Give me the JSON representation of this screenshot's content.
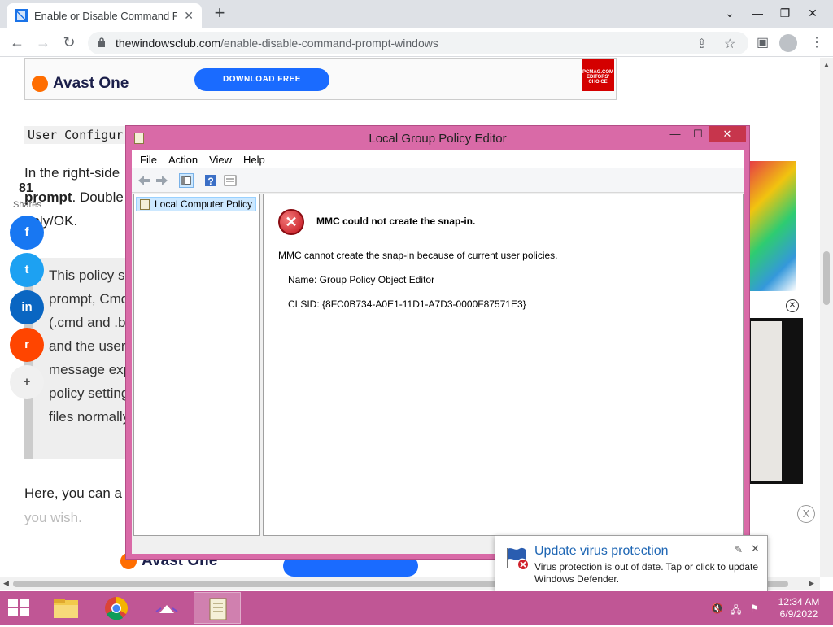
{
  "browser": {
    "tab_title": "Enable or Disable Command Pro",
    "tab_close": "✕",
    "new_tab": "+",
    "url_domain": "thewindowsclub.com",
    "url_path": "/enable-disable-command-prompt-windows",
    "window_controls": {
      "chevron": "⌄",
      "minimize": "—",
      "restore": "❐",
      "close": "✕"
    }
  },
  "page": {
    "ad_top": {
      "brand": "Avast One",
      "button": "DOWNLOAD FREE",
      "badge": "PCMAG.COM EDITORS' CHOICE"
    },
    "code_line": "User Configur",
    "para1_line1": "In the right-side",
    "para1_line2_bold": "prompt",
    "para1_line2_rest": ". Double",
    "para1_line3": "pply/OK.",
    "quote_lines": [
      "This policy se",
      "prompt, Cmd",
      "(.cmd and .ba",
      "and the user",
      "message exp",
      "policy setting",
      "files normally"
    ],
    "para2_line1": "Here, you can a",
    "para2_line2": "you wish.",
    "share_count": "81",
    "share_label": "Shares",
    "share_buttons": [
      {
        "name": "facebook",
        "glyph": "f",
        "color": "#1877f2"
      },
      {
        "name": "twitter",
        "glyph": "t",
        "color": "#1da1f2"
      },
      {
        "name": "linkedin",
        "glyph": "in",
        "color": "#0a66c2"
      },
      {
        "name": "reddit",
        "glyph": "r",
        "color": "#ff4500"
      },
      {
        "name": "more",
        "glyph": "+",
        "color": "#f0f0f0"
      }
    ],
    "side_ad_close": "✕",
    "ad_bottom": {
      "brand": "Avast One",
      "close": "X"
    }
  },
  "mmc": {
    "title": "Local Group Policy Editor",
    "controls": {
      "minimize": "—",
      "maximize": "☐",
      "close": "✕"
    },
    "menu": [
      "File",
      "Action",
      "View",
      "Help"
    ],
    "tree_node": "Local Computer Policy",
    "error_title": "MMC could not create the snap-in.",
    "error_message": "MMC cannot create the snap-in because of current user policies.",
    "name_line": "Name: Group Policy Object Editor",
    "clsid_line": "CLSID: {8FC0B734-A0E1-11D1-A7D3-0000F87571E3}"
  },
  "notification": {
    "title": "Update virus protection",
    "body": "Virus protection is out of date. Tap or click to update Windows Defender.",
    "close": "✕"
  },
  "taskbar": {
    "time": "12:34 AM",
    "date": "6/9/2022",
    "color": "#c05695"
  }
}
